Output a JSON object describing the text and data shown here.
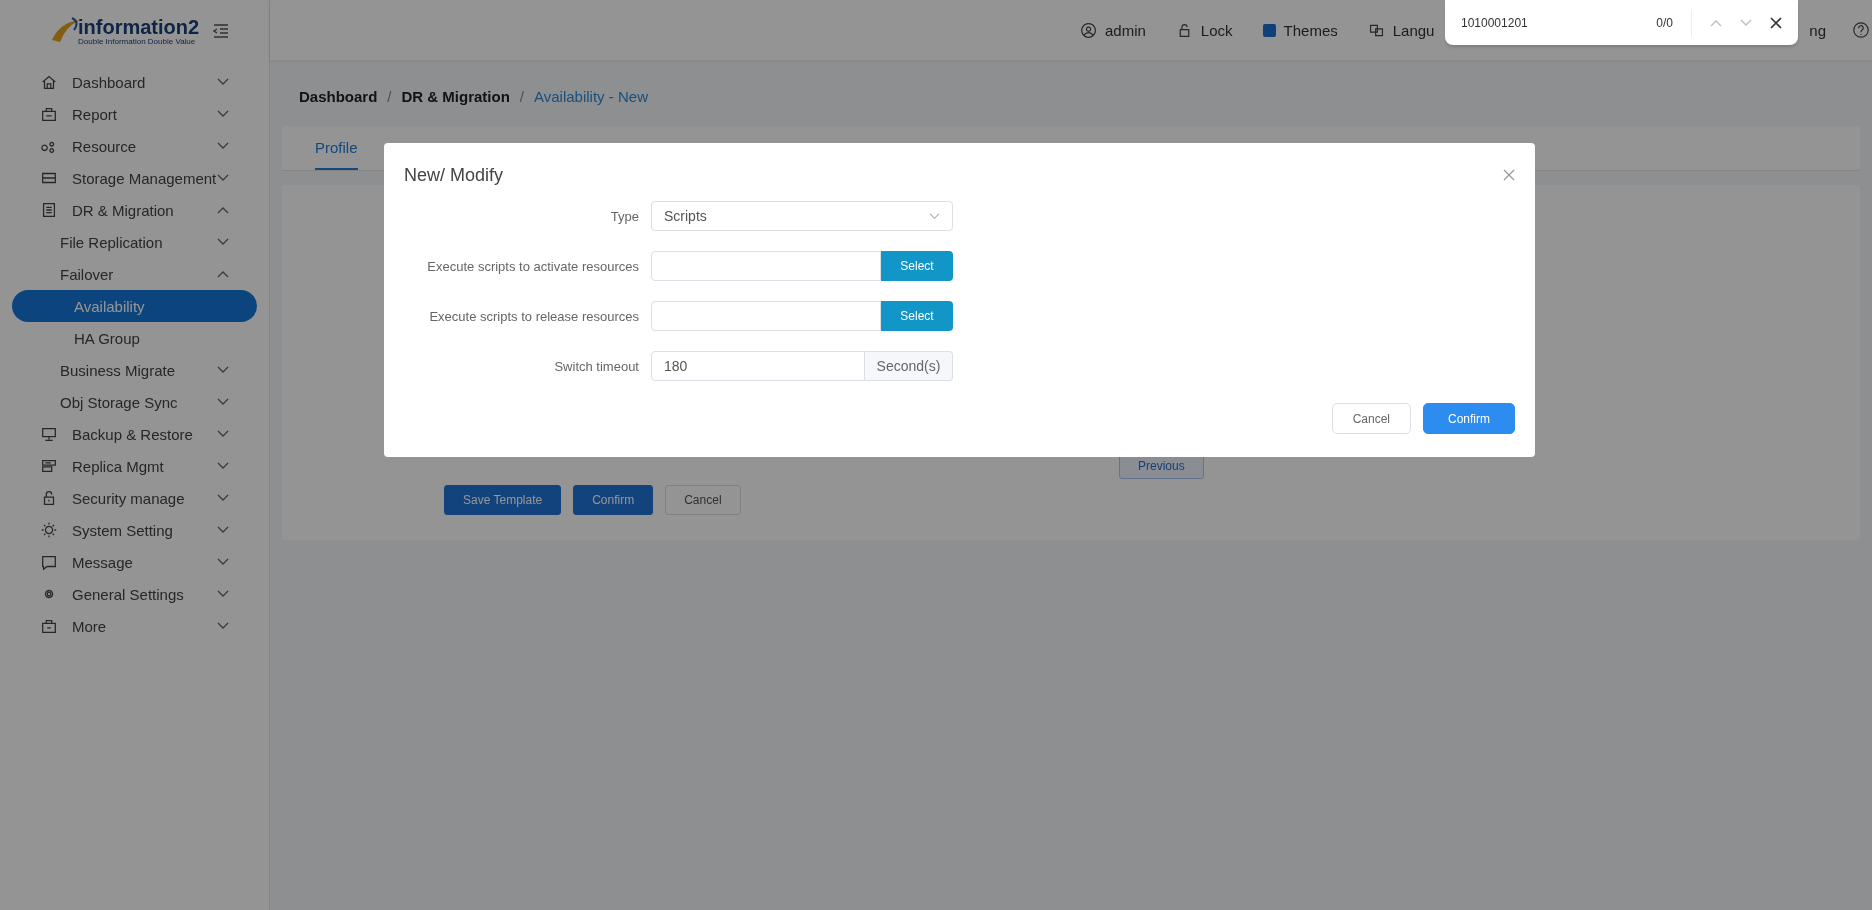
{
  "logo": {
    "name": "information2",
    "tagline": "Double Information Double Value"
  },
  "topbar": {
    "items": [
      {
        "kind": "user",
        "label": "admin"
      },
      {
        "kind": "lock",
        "label": "Lock"
      },
      {
        "kind": "themes",
        "label": "Themes"
      },
      {
        "kind": "language",
        "label": "Langu"
      }
    ],
    "trailing_text": "ng"
  },
  "sidebar": {
    "items": [
      {
        "kind": "home",
        "label": "Dashboard",
        "expanded": false
      },
      {
        "kind": "report",
        "label": "Report",
        "expanded": false
      },
      {
        "kind": "resource",
        "label": "Resource",
        "expanded": false
      },
      {
        "kind": "storage",
        "label": "Storage Management",
        "expanded": false
      },
      {
        "kind": "dr",
        "label": "DR & Migration",
        "expanded": true,
        "children": [
          {
            "label": "File Replication",
            "expanded": false
          },
          {
            "label": "Failover",
            "expanded": true,
            "children": [
              {
                "label": "Availability",
                "selected": true
              },
              {
                "label": "HA Group",
                "selected": false
              }
            ]
          },
          {
            "label": "Business Migrate",
            "expanded": false
          },
          {
            "label": "Obj Storage Sync",
            "expanded": false
          }
        ]
      },
      {
        "kind": "backup",
        "label": "Backup & Restore",
        "expanded": false
      },
      {
        "kind": "replica",
        "label": "Replica Mgmt",
        "expanded": false
      },
      {
        "kind": "security",
        "label": "Security manage",
        "expanded": false
      },
      {
        "kind": "system",
        "label": "System Setting",
        "expanded": false
      },
      {
        "kind": "message",
        "label": "Message",
        "expanded": false
      },
      {
        "kind": "general",
        "label": "General Settings",
        "expanded": false
      },
      {
        "kind": "more",
        "label": "More",
        "expanded": false
      }
    ]
  },
  "breadcrumb": {
    "separator": "/",
    "items": [
      {
        "label": "Dashboard",
        "current": false
      },
      {
        "label": "DR & Migration",
        "current": false
      },
      {
        "label": "Availability - New",
        "current": true
      }
    ]
  },
  "tabs": [
    {
      "label": "Profile",
      "selected": true
    }
  ],
  "page_buttons": [
    {
      "label": "Save Template",
      "kind": "primary"
    },
    {
      "label": "Confirm",
      "kind": "primary"
    },
    {
      "label": "Cancel",
      "kind": "default"
    }
  ],
  "previous_button": "Previous",
  "dialog": {
    "title": "New/ Modify",
    "fields": [
      {
        "kind": "select",
        "label": "Type",
        "value": "Scripts"
      },
      {
        "kind": "picker",
        "label": "Execute scripts to activate resources",
        "button": "Select"
      },
      {
        "kind": "picker",
        "label": "Execute scripts to release resources",
        "button": "Select"
      },
      {
        "kind": "unit",
        "label": "Switch timeout",
        "value": "180",
        "unit": "Second(s)"
      }
    ],
    "buttons": [
      {
        "label": "Cancel",
        "kind": "default"
      },
      {
        "label": "Confirm",
        "kind": "primary"
      }
    ]
  },
  "find_bar": {
    "query": "1010001201",
    "count": "0/0"
  }
}
